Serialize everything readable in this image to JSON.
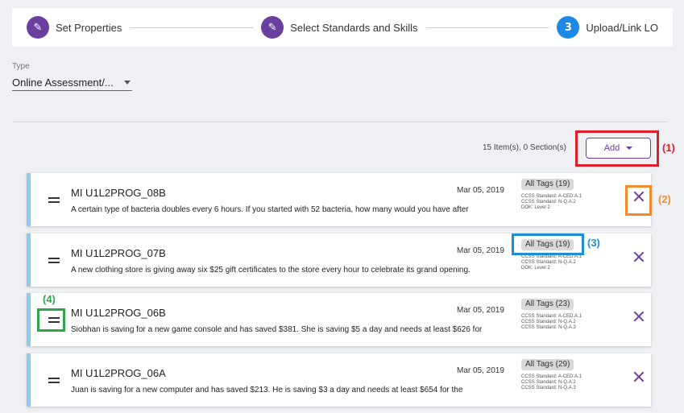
{
  "stepper": {
    "steps": [
      {
        "icon": "pencil-icon",
        "glyph": "✎",
        "label": "Set Properties"
      },
      {
        "icon": "pencil-icon",
        "glyph": "✎",
        "label": "Select Standards and Skills"
      },
      {
        "number": "3",
        "label": "Upload/Link LO"
      }
    ]
  },
  "type_field": {
    "label": "Type",
    "value": "Online Assessment/..."
  },
  "summary": {
    "count_text": "15 Item(s), 0 Section(s)"
  },
  "add_button": {
    "label": "Add"
  },
  "annotations": {
    "a1": "(1)",
    "a2": "(2)",
    "a3": "(3)",
    "a4": "(4)"
  },
  "items": [
    {
      "title": "MI U1L2PROG_08B",
      "date": "Mar 05, 2019",
      "description": "A certain type of bacteria doubles every 6 hours. If you started with 52 bacteria, how many would you have after",
      "tags": "All Tags (19)",
      "standards": [
        "CCSS Standard: A-CED.A.1",
        "CCSS Standard: N-Q.A.2",
        "DOK: Level 2"
      ]
    },
    {
      "title": "MI U1L2PROG_07B",
      "date": "Mar 05, 2019",
      "description": "A new clothing store is giving away six $25 gift certificates to the store every hour to celebrate its grand opening.",
      "tags": "All Tags (19)",
      "standards": [
        "CCSS Standard: A-CED.A.1",
        "CCSS Standard: N-Q.A.2",
        "DOK: Level 2"
      ]
    },
    {
      "title": "MI U1L2PROG_06B",
      "date": "Mar 05, 2019",
      "description": "Siobhan is saving for a new game console and has saved $381. She is saving $5 a day and needs at least $626 for",
      "tags": "All Tags (23)",
      "standards": [
        "CCSS Standard: A-CED.A.1",
        "CCSS Standard: N-Q.A.2",
        "CCSS Standard: N-Q.A.3"
      ]
    },
    {
      "title": "MI U1L2PROG_06A",
      "date": "Mar 05, 2019",
      "description": "Juan is saving for a new computer and has saved $213. He is saving $3 a day and needs at least $654 for the",
      "tags": "All Tags (29)",
      "standards": [
        "CCSS Standard: A-CED.A.1",
        "CCSS Standard: N-Q.A.2",
        "CCSS Standard: N-Q.A.3"
      ]
    }
  ],
  "colors": {
    "primary": "#6b3fa0",
    "active_step": "#1e88e5",
    "card_accent": "#8ec9ee",
    "anno_red": "#e21d2a",
    "anno_orange": "#f28a2e",
    "anno_blue": "#1a8fd8",
    "anno_green": "#2ea44f"
  }
}
